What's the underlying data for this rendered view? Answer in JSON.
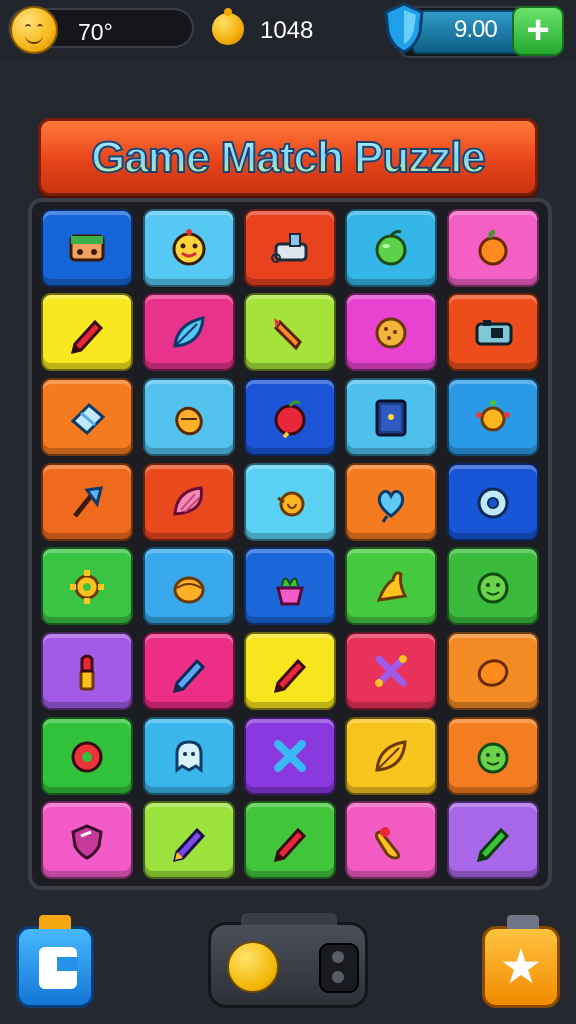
{
  "hud": {
    "level": "70°",
    "coins": "1048",
    "gems": "9.00",
    "add_label": "+"
  },
  "title": "Game Match Puzzle",
  "grid": {
    "rows": 8,
    "cols": 5,
    "tiles": [
      {
        "color": "#1565d8",
        "icon": "cassette"
      },
      {
        "color": "#55c8f3",
        "icon": "smiley"
      },
      {
        "color": "#e8421f",
        "icon": "gadget"
      },
      {
        "color": "#35b6e8",
        "icon": "apple"
      },
      {
        "color": "#f35fc4",
        "icon": "orange"
      },
      {
        "color": "#f7e81f",
        "icon": "pencil"
      },
      {
        "color": "#e8328c",
        "icon": "leaf"
      },
      {
        "color": "#a6e33a",
        "icon": "crayon"
      },
      {
        "color": "#e843d0",
        "icon": "cookie"
      },
      {
        "color": "#ec4d1a",
        "icon": "camera"
      },
      {
        "color": "#f47b20",
        "icon": "eraser"
      },
      {
        "color": "#53c2ef",
        "icon": "acorn"
      },
      {
        "color": "#1b55d6",
        "icon": "apple-red"
      },
      {
        "color": "#4fbfee",
        "icon": "book"
      },
      {
        "color": "#2b9ae6",
        "icon": "sun"
      },
      {
        "color": "#f06a1e",
        "icon": "brush"
      },
      {
        "color": "#e84a1d",
        "icon": "shell"
      },
      {
        "color": "#5ad0f3",
        "icon": "snail"
      },
      {
        "color": "#f47b20",
        "icon": "heart"
      },
      {
        "color": "#1855d6",
        "icon": "donut"
      },
      {
        "color": "#39c444",
        "icon": "gear"
      },
      {
        "color": "#37a9ec",
        "icon": "bun"
      },
      {
        "color": "#1b67da",
        "icon": "plant"
      },
      {
        "color": "#45c93f",
        "icon": "cheese"
      },
      {
        "color": "#3bba3e",
        "icon": "face-green"
      },
      {
        "color": "#a15be6",
        "icon": "lipstick"
      },
      {
        "color": "#ec2e86",
        "icon": "pencil-blue"
      },
      {
        "color": "#f7e51e",
        "icon": "pencil"
      },
      {
        "color": "#e8325b",
        "icon": "cross"
      },
      {
        "color": "#f38a24",
        "icon": "lemon"
      },
      {
        "color": "#31c23c",
        "icon": "flower"
      },
      {
        "color": "#3bb6ec",
        "icon": "ghost"
      },
      {
        "color": "#8a38df",
        "icon": "x-blue"
      },
      {
        "color": "#f8c51f",
        "icon": "leaf-gold"
      },
      {
        "color": "#f37d20",
        "icon": "face-green"
      },
      {
        "color": "#f25bc7",
        "icon": "shield"
      },
      {
        "color": "#9be33c",
        "icon": "pencil-purple"
      },
      {
        "color": "#40c53b",
        "icon": "pencil"
      },
      {
        "color": "#f15bc3",
        "icon": "capsule"
      },
      {
        "color": "#a866e8",
        "icon": "pencil-green"
      }
    ]
  },
  "bottom": {
    "left_icon": "k-block-icon",
    "center_icon": "yellow-bubble-icon",
    "right_icon": "star-icon",
    "star_glyph": "★"
  }
}
